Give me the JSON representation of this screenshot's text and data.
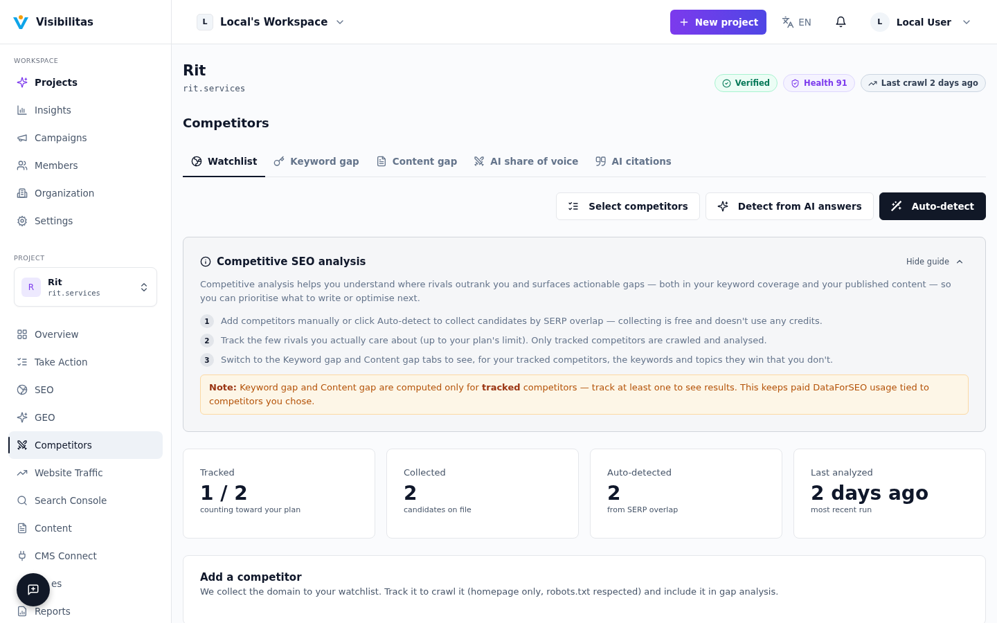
{
  "brand": {
    "name": "Visibilitas"
  },
  "workspace": {
    "avatar": "L",
    "name": "Local's Workspace"
  },
  "header": {
    "new_project": "New project",
    "language": "EN",
    "user": {
      "avatar": "L",
      "name": "Local User"
    }
  },
  "sidebar": {
    "sections": [
      {
        "title": "WORKSPACE",
        "items": [
          {
            "label": "Projects",
            "selected": false,
            "highlighted": true
          },
          {
            "label": "Insights",
            "selected": false,
            "highlighted": false
          },
          {
            "label": "Campaigns",
            "selected": false,
            "highlighted": false
          },
          {
            "label": "Members",
            "selected": false,
            "highlighted": false
          },
          {
            "label": "Organization",
            "selected": false,
            "highlighted": false
          },
          {
            "label": "Settings",
            "selected": false,
            "highlighted": false
          }
        ]
      },
      {
        "title": "PROJECT",
        "project": {
          "avatar": "R",
          "name": "Rit",
          "domain": "rit.services"
        },
        "items": [
          {
            "label": "Overview",
            "selected": false,
            "highlighted": false
          },
          {
            "label": "Take Action",
            "selected": false,
            "highlighted": false
          },
          {
            "label": "SEO",
            "selected": false,
            "highlighted": false
          },
          {
            "label": "GEO",
            "selected": false,
            "highlighted": false
          },
          {
            "label": "Competitors",
            "selected": true,
            "highlighted": false
          },
          {
            "label": "Website Traffic",
            "selected": false,
            "highlighted": false
          },
          {
            "label": "Search Console",
            "selected": false,
            "highlighted": false
          },
          {
            "label": "Content",
            "selected": false,
            "highlighted": false
          },
          {
            "label": "CMS Connect",
            "selected": false,
            "highlighted": false
          },
          {
            "label": "es",
            "selected": false,
            "highlighted": false,
            "covered": true
          },
          {
            "label": "Reports",
            "selected": false,
            "highlighted": false
          }
        ]
      }
    ]
  },
  "page": {
    "title": "Rit",
    "domain": "rit.services",
    "badges": [
      {
        "label": "Verified",
        "kind": "success"
      },
      {
        "label": "Health 91",
        "kind": "health"
      },
      {
        "label": "Last crawl 2 days ago",
        "kind": "neutral"
      }
    ],
    "section_title": "Competitors",
    "tabs": [
      {
        "label": "Watchlist",
        "selected": true
      },
      {
        "label": "Keyword gap",
        "selected": false
      },
      {
        "label": "Content gap",
        "selected": false
      },
      {
        "label": "AI share of voice",
        "selected": false
      },
      {
        "label": "AI citations",
        "selected": false
      }
    ],
    "actions": [
      {
        "label": "Select competitors",
        "kind": "outline"
      },
      {
        "label": "Detect from AI answers",
        "kind": "outline"
      },
      {
        "label": "Auto-detect",
        "kind": "primary"
      }
    ],
    "guide": {
      "title": "Competitive SEO analysis",
      "toggle": "Hide guide",
      "intro": "Competitive analysis helps you understand where rivals outrank you and surfaces actionable gaps — both in your keyword coverage and your published content — so you can prioritise what to write or optimise next.",
      "steps": [
        {
          "number": "1",
          "text": "Add competitors manually or click Auto-detect to collect candidates by SERP overlap — collecting is free and doesn't use any credits."
        },
        {
          "number": "2",
          "text": "Track the few rivals you actually care about (up to your plan's limit). Only tracked competitors are crawled and analysed."
        },
        {
          "number": "3",
          "text": "Switch to the Keyword gap and Content gap tabs to see, for your tracked competitors, the keywords and topics they win that you don't."
        }
      ],
      "note": "**Note:** Keyword gap and Content gap are computed only for **tracked** competitors — track at least one to see results. This keeps paid DataForSEO usage tied to competitors you chose."
    },
    "stats": [
      {
        "label": "Tracked",
        "value": "1 / 2",
        "caption": "counting toward your plan"
      },
      {
        "label": "Collected",
        "value": "2",
        "caption": "candidates on file"
      },
      {
        "label": "Auto-detected",
        "value": "2",
        "caption": "from SERP overlap"
      },
      {
        "label": "Last analyzed",
        "value": "2 days ago",
        "caption": "most recent run"
      }
    ],
    "add_card": {
      "title": "Add a competitor",
      "description": "We collect the domain to your watchlist. Track it to crawl it (homepage only, robots.txt respected) and include it in gap analysis."
    }
  }
}
